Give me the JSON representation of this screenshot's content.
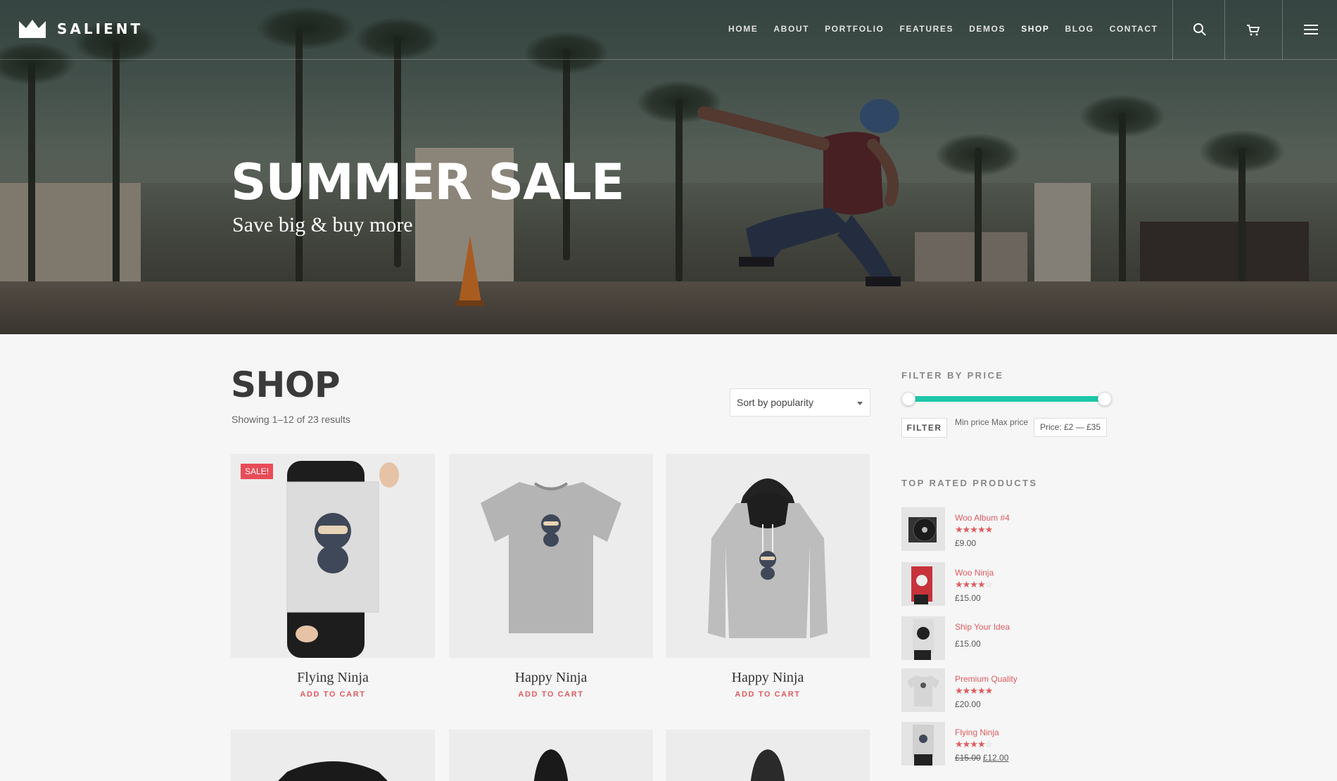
{
  "brand": {
    "name": "SALIENT"
  },
  "nav": {
    "items": [
      {
        "label": "HOME"
      },
      {
        "label": "ABOUT"
      },
      {
        "label": "PORTFOLIO"
      },
      {
        "label": "FEATURES"
      },
      {
        "label": "DEMOS"
      },
      {
        "label": "SHOP",
        "active": true
      },
      {
        "label": "BLOG"
      },
      {
        "label": "CONTACT"
      }
    ],
    "icons": [
      "search-icon",
      "cart-icon",
      "menu-icon"
    ]
  },
  "hero": {
    "title": "SUMMER SALE",
    "subtitle": "Save big & buy more"
  },
  "shop": {
    "title": "SHOP",
    "results": "Showing 1–12 of 23 results",
    "sort": {
      "selected": "Sort by popularity"
    },
    "products": [
      {
        "name": "Flying Ninja",
        "cta": "ADD TO CART",
        "badge": "SALE!"
      },
      {
        "name": "Happy Ninja",
        "cta": "ADD TO CART"
      },
      {
        "name": "Happy Ninja",
        "cta": "ADD TO CART"
      }
    ]
  },
  "sidebar": {
    "filter": {
      "heading": "FILTER BY PRICE",
      "button": "FILTER",
      "min_max_label": "Min price Max price",
      "price_label": "Price: £2 — £35",
      "range_min": 2,
      "range_max": 35
    },
    "top_rated": {
      "heading": "TOP RATED PRODUCTS",
      "items": [
        {
          "name": "Woo Album #4",
          "rating": 5,
          "price": "£9.00"
        },
        {
          "name": "Woo Ninja",
          "rating": 4,
          "price": "£15.00"
        },
        {
          "name": "Ship Your Idea",
          "rating": 0,
          "price": "£15.00"
        },
        {
          "name": "Premium Quality",
          "rating": 4.5,
          "price": "£20.00"
        },
        {
          "name": "Flying Ninja",
          "rating": 4,
          "old_price": "£15.00",
          "price": "£12.00"
        }
      ]
    }
  },
  "colors": {
    "accent": "#e05b60",
    "slider": "#1cc7a8",
    "sale_badge": "#e84c58"
  }
}
